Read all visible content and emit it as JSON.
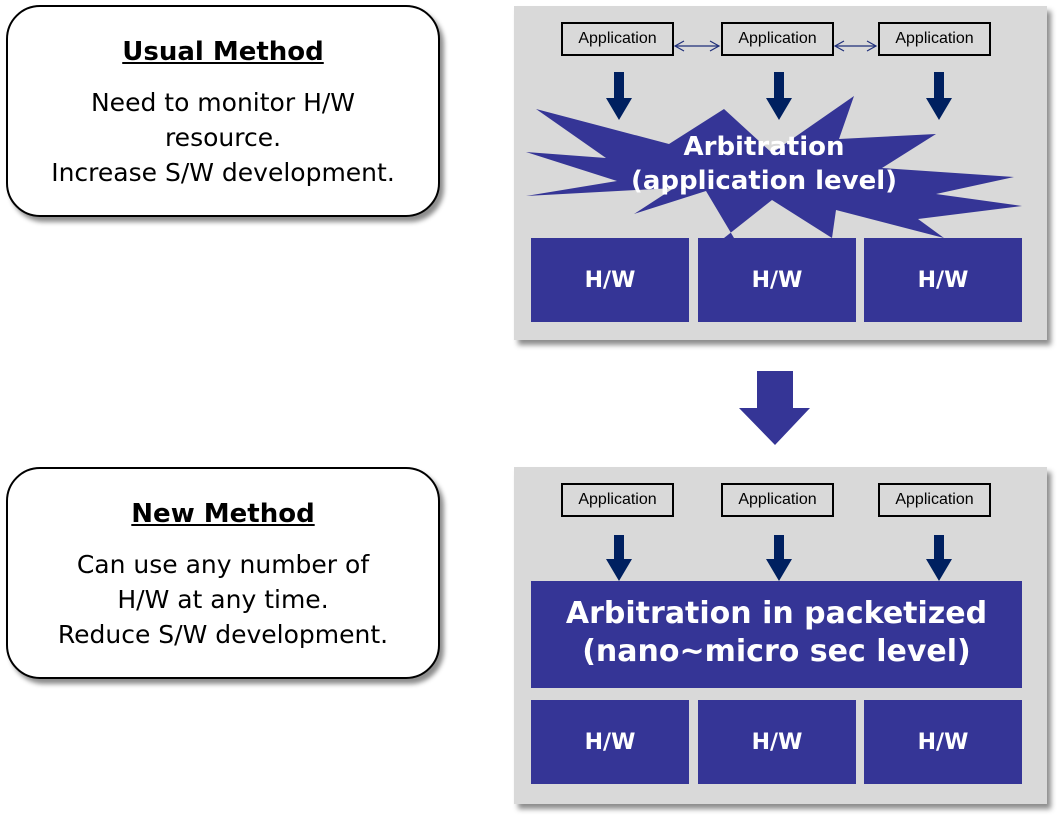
{
  "usual_method": {
    "title": "Usual Method",
    "description": "Need to monitor H/W\nresource.\nIncrease S/W development."
  },
  "new_method": {
    "title": "New Method",
    "description": "Can use any number of\nH/W at any time.\nReduce S/W development."
  },
  "usual_diagram": {
    "applications": [
      "Application",
      "Application",
      "Application"
    ],
    "arbitration_line1": "Arbitration",
    "arbitration_line2": "(application level)",
    "hardware": [
      "H/W",
      "H/W",
      "H/W"
    ]
  },
  "new_diagram": {
    "applications": [
      "Application",
      "Application",
      "Application"
    ],
    "arbitration_line1": "Arbitration in packetized",
    "arbitration_line2": "(nano~micro sec level)",
    "hardware": [
      "H/W",
      "H/W",
      "H/W"
    ]
  },
  "colors": {
    "hw_fill": "#353596",
    "arrow_dark": "#002060",
    "panel_bg": "#d9d9d9"
  }
}
